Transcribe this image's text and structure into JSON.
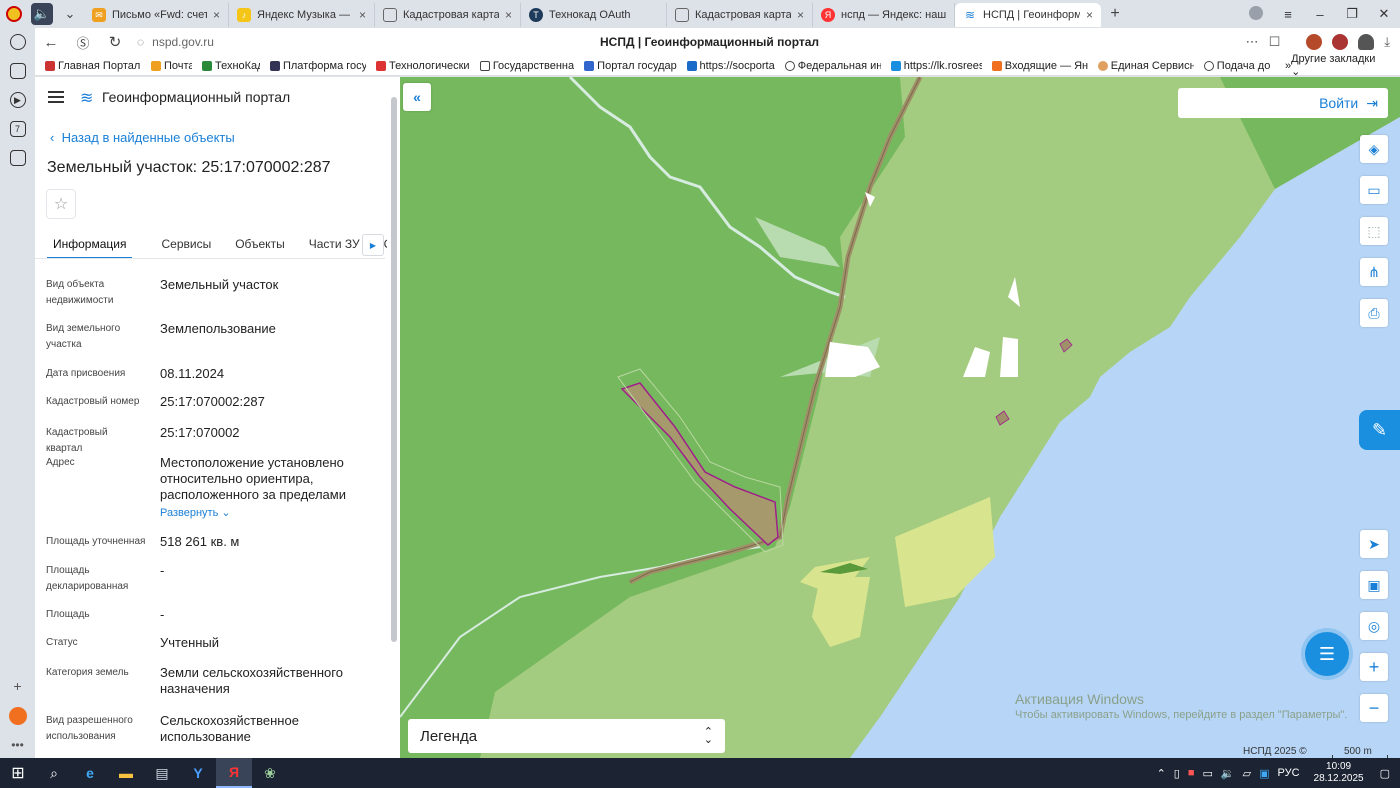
{
  "browser": {
    "tabs": [
      {
        "title": "Письмо «Fwd: счет за дек",
        "close": "×"
      },
      {
        "title": "Яндекс Музыка — с",
        "close": "×"
      },
      {
        "title": "Кадастровая карта Сибир",
        "close": "×"
      },
      {
        "title": "Технокад OAuth",
        "close": "×"
      },
      {
        "title": "Кадастровая карта Сибир",
        "close": "×"
      },
      {
        "title": "нспд — Яндекс: нашлось",
        "close": "×"
      },
      {
        "title": "НСПД | Геоинформацио",
        "close": "×"
      }
    ],
    "new_tab": "+",
    "url": "nspd.gov.ru",
    "page_title": "НСПД | Геоинформационный портал",
    "bookmarks": [
      "Главная Портал З",
      "Почта",
      "ТехноКад",
      "Платформа госуд",
      "Технологический",
      "Государственная",
      "Портал государс",
      "https://socportal.",
      "Федеральная инф",
      "https://lk.rosreest",
      "Входящие — Янде",
      "Единая Сервисна",
      "Подача док"
    ],
    "bookmarks_overflow": "»",
    "other_bookmarks": "Другие закладки",
    "rail_badge": "7"
  },
  "panel": {
    "portal_title": "Геоинформационный портал",
    "back_link": "Назад в найденные объекты",
    "object_title": "Земельный участок: 25:17:070002:287",
    "tabs": [
      "Информация",
      "Сервисы",
      "Объекты",
      "Части ЗУ",
      "Соста"
    ],
    "fields": [
      {
        "label": "Вид объекта недвижимости",
        "value": "Земельный участок"
      },
      {
        "label": "Вид земельного участка",
        "value": "Землепользование"
      },
      {
        "label": "Дата присвоения",
        "value": "08.11.2024"
      },
      {
        "label": "Кадастровый номер",
        "value": "25:17:070002:287"
      },
      {
        "label": "Кадастровый квартал",
        "value": "25:17:070002"
      },
      {
        "label": "Адрес",
        "value": "Местоположение установлено относительно ориентира, расположенного за пределами",
        "expand": "Развернуть"
      },
      {
        "label": "Площадь уточненная",
        "value": "518 261 кв. м"
      },
      {
        "label": "Площадь декларированная",
        "value": "-"
      },
      {
        "label": "Площадь",
        "value": "-"
      },
      {
        "label": "Статус",
        "value": "Учтенный"
      },
      {
        "label": "Категория земель",
        "value": "Земли сельскохозяйственного назначения"
      },
      {
        "label": "Вид разрешенного использования",
        "value": "Сельскохозяйственное использование"
      }
    ]
  },
  "map": {
    "login": "Войти",
    "legend": "Легенда",
    "watermark_title": "Активация Windows",
    "watermark_sub": "Чтобы активировать Windows, перейдите в раздел \"Параметры\".",
    "copyright": "НСПД 2025 ©",
    "scale": "500 m",
    "colors": {
      "forest": "#76b85d",
      "agri": "#a4cc80",
      "water": "#b7d6f7",
      "parcel": "#a0906a",
      "parcel_outline": "#a0208a"
    }
  },
  "taskbar": {
    "lang": "РУС",
    "time": "10:09",
    "date": "28.12.2025"
  }
}
